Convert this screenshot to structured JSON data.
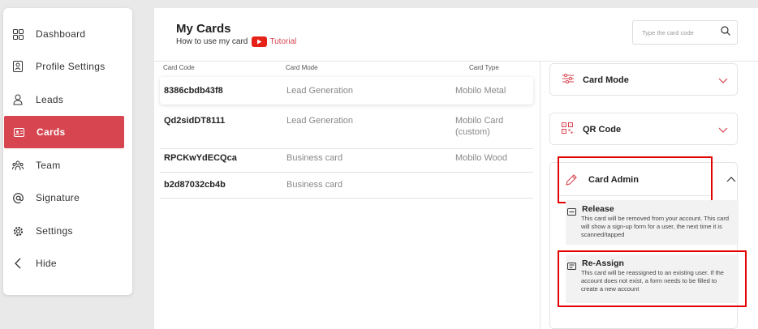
{
  "sidebar": {
    "items": [
      {
        "label": "Dashboard",
        "icon": "dashboard-icon"
      },
      {
        "label": "Profile Settings",
        "icon": "profile-icon"
      },
      {
        "label": "Leads",
        "icon": "user-icon"
      },
      {
        "label": "Cards",
        "icon": "card-icon",
        "active": true
      },
      {
        "label": "Team",
        "icon": "team-icon"
      },
      {
        "label": "Signature",
        "icon": "at-icon"
      },
      {
        "label": "Settings",
        "icon": "gear-icon"
      },
      {
        "label": "Hide",
        "icon": "chevron-left-icon"
      }
    ]
  },
  "header": {
    "title": "My Cards",
    "howto": "How to use my card",
    "tutorial": "Tutorial",
    "search_placeholder": "Type the card code"
  },
  "table": {
    "columns": [
      "Card Code",
      "Card Mode",
      "Card Type"
    ],
    "rows": [
      {
        "code": "8386cbdb43f8",
        "mode": "Lead Generation",
        "type": "Mobilo Metal"
      },
      {
        "code": "Qd2sidDT8111",
        "mode": "Lead Generation",
        "type_line1": "Mobilo Card",
        "type_line2": "(custom)"
      },
      {
        "code": "RPCKwYdECQca",
        "mode": "Business card",
        "type": "Mobilo Wood"
      },
      {
        "code": "b2d87032cb4b",
        "mode": "Business card",
        "type": ""
      }
    ]
  },
  "panels": {
    "card_mode": "Card Mode",
    "qr_code": "QR Code",
    "card_admin": "Card Admin",
    "release": {
      "title": "Release",
      "desc": "This card will be removed from your account. This card will show a sign-up form for a user, the next time it is scanned/tapped"
    },
    "reassign": {
      "title": "Re-Assign",
      "desc": "This card will be reassigned to an existing user. If the account does not exist, a form needs to be filled to create a new account"
    }
  },
  "colors": {
    "accent": "#d64550",
    "highlight_border": "#e30000",
    "youtube": "#e62117"
  }
}
